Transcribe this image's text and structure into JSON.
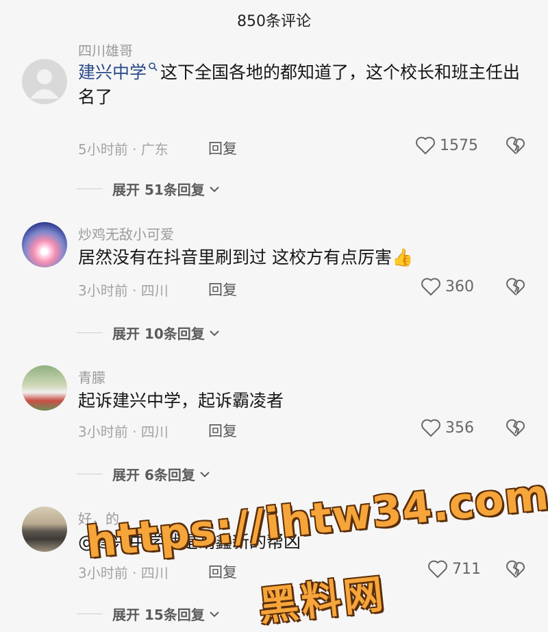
{
  "header": {
    "title": "850条评论"
  },
  "comments": [
    {
      "username": "四川雄哥",
      "link": "建兴中学",
      "text": "这下全国各地的都知道了，这个校长和班主任出名了",
      "time": "5小时前 · 广东",
      "reply_label": "回复",
      "likes": "1575",
      "expand": "展开 51条回复"
    },
    {
      "username": "炒鸡无敌小可爱",
      "text": "居然没有在抖音里刷到过   这校方有点厉害👍",
      "time": "3小时前 · 四川",
      "reply_label": "回复",
      "likes": "360",
      "expand": "展开 10条回复"
    },
    {
      "username": "青朦",
      "text": "起诉建兴中学，起诉霸凌者",
      "time": "3小时前 · 四川",
      "reply_label": "回复",
      "likes": "356",
      "expand": "展开 6条回复"
    },
    {
      "username": "好，的",
      "text": "@建兴中学就是胡鑫新的帮凶",
      "time": "3小时前 · 四川",
      "reply_label": "回复",
      "likes": "711",
      "expand": "展开 15条回复"
    }
  ],
  "watermark": {
    "line1": "https://ihtw34.com",
    "line2": "黑料网"
  },
  "colors": {
    "link": "#2b4a8a",
    "watermark": "#f6a53a"
  }
}
